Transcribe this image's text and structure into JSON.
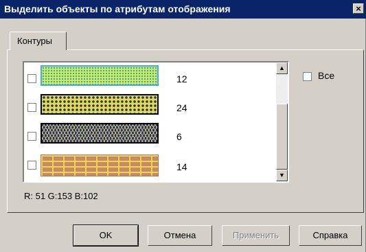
{
  "dialog": {
    "title": "Выделить объекты по атрибутам отображения",
    "close_label": "×"
  },
  "tabs": [
    {
      "label": "Контуры"
    }
  ],
  "list": {
    "items": [
      {
        "count": "12"
      },
      {
        "count": "24"
      },
      {
        "count": "6"
      },
      {
        "count": "14"
      }
    ]
  },
  "all_checkbox": {
    "label": "Все"
  },
  "color_readout": "R: 51 G:153 B:102",
  "buttons": {
    "ok": "OK",
    "cancel": "Отмена",
    "apply": "Применить",
    "help": "Справка"
  },
  "colors": {
    "title_bar": "#0a246a",
    "dialog_bg": "#d4d0c8"
  },
  "icons": {
    "scroll_up": "scroll-up-arrow-icon",
    "scroll_down": "scroll-down-arrow-icon"
  }
}
